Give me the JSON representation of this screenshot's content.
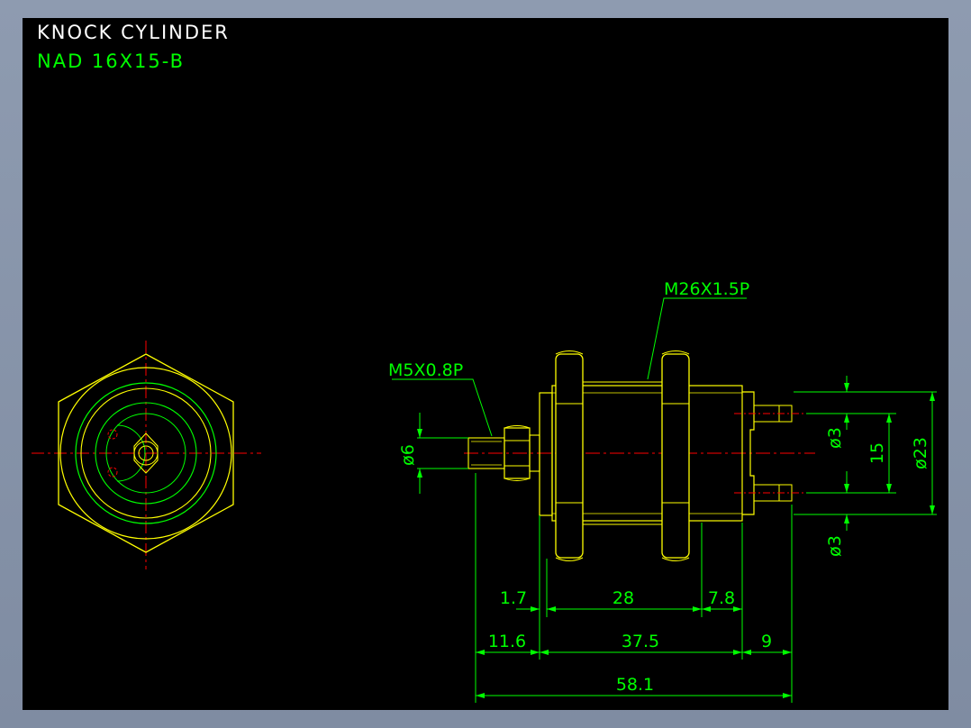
{
  "drawing": {
    "title": "KNOCK  CYLINDER",
    "model": "NAD 16X15-B",
    "colors": {
      "background": "#000000",
      "outline": "#ffff00",
      "dimension": "#00ff00",
      "centerline": "#ff0000",
      "title": "#ffffff"
    },
    "callouts": {
      "body_thread": "M26X1.5P",
      "rod_thread": "M5X0.8P"
    },
    "dimensions": {
      "rod_diameter": "ø6",
      "port_diameter_top": "ø3",
      "port_diameter_bottom": "ø3",
      "port_pitch": "15",
      "body_diameter": "ø23",
      "d_1_7": "1.7",
      "d_28": "28",
      "d_7_8": "7.8",
      "d_11_6": "11.6",
      "d_37_5": "37.5",
      "d_9": "9",
      "d_58_1": "58.1"
    }
  }
}
